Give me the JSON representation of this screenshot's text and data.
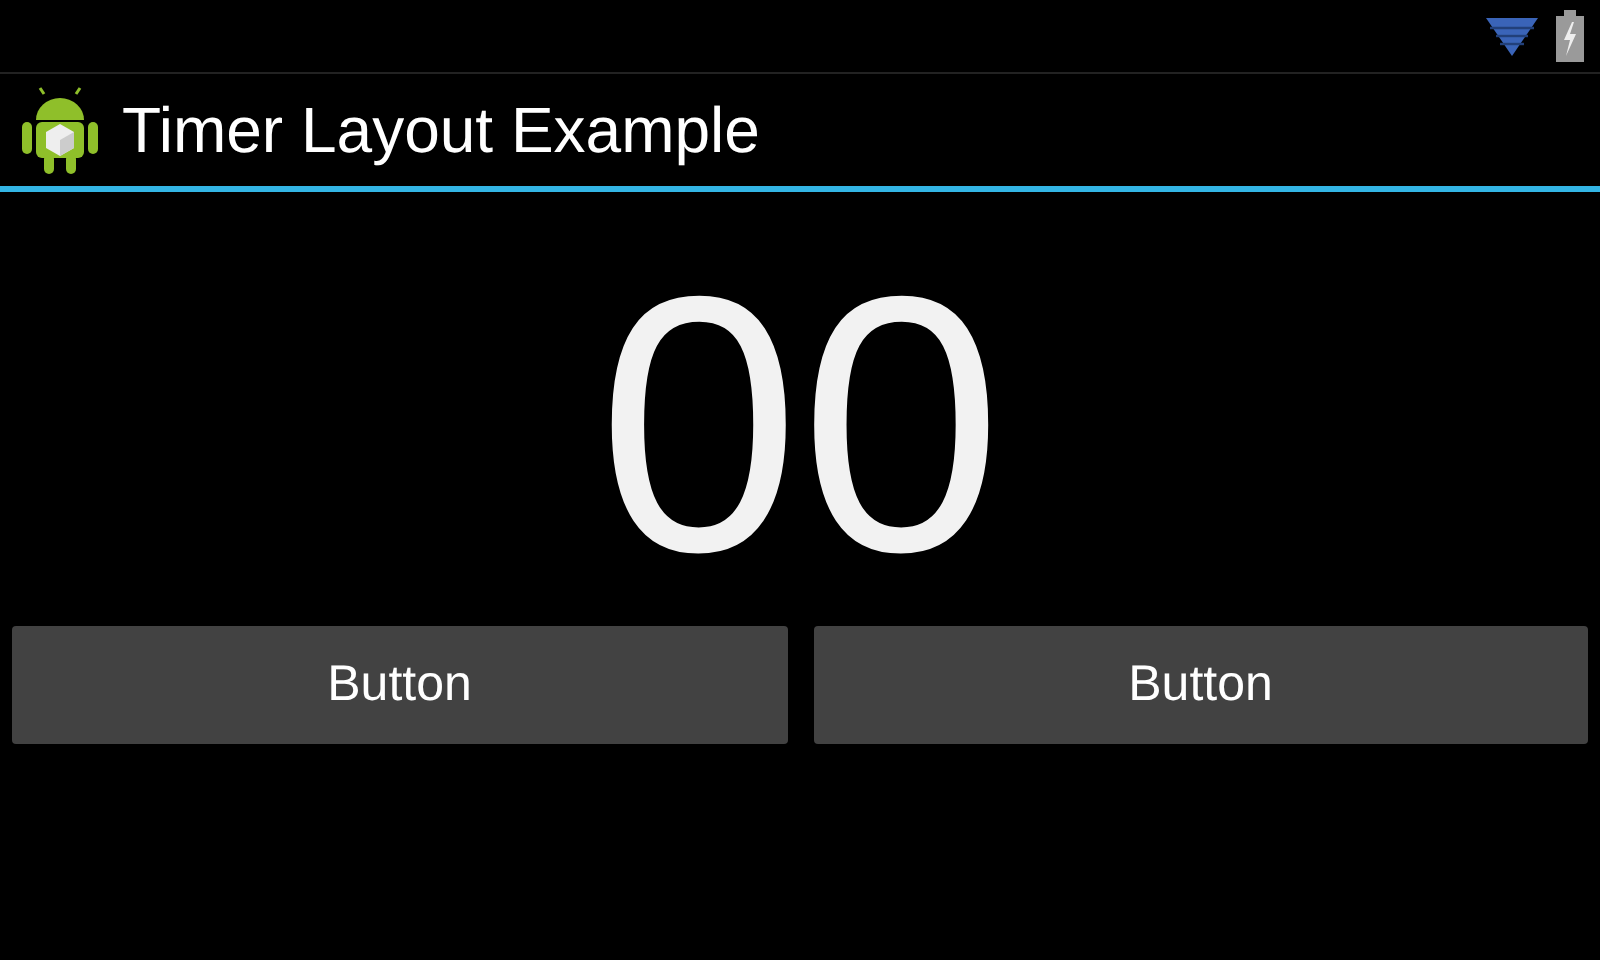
{
  "action_bar": {
    "title": "Timer Layout Example"
  },
  "timer": {
    "value": "00"
  },
  "buttons": [
    {
      "label": "Button"
    },
    {
      "label": "Button"
    }
  ]
}
